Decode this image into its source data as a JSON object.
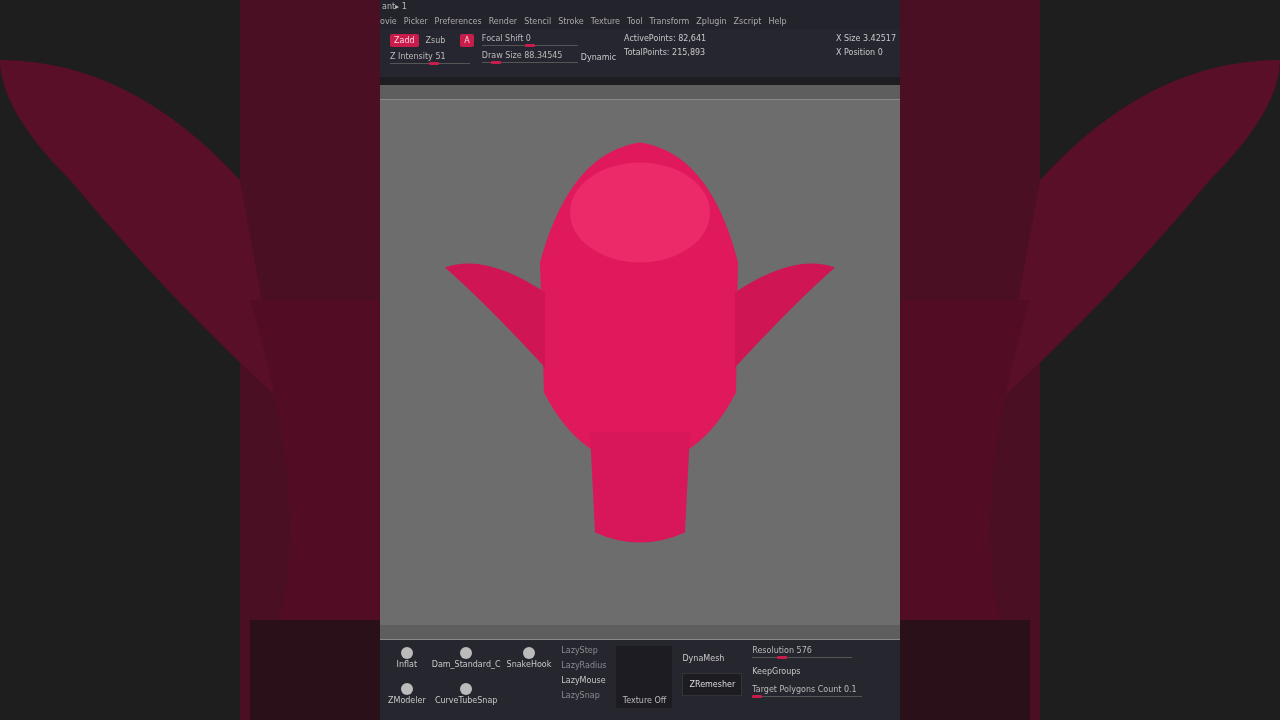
{
  "window": {
    "title": "ant▸ 1"
  },
  "menu": [
    "ovie",
    "Picker",
    "Preferences",
    "Render",
    "Stencil",
    "Stroke",
    "Texture",
    "Tool",
    "Transform",
    "Zplugin",
    "Zscript",
    "Help"
  ],
  "toolbar": {
    "modes": [
      {
        "label": "Zadd",
        "selected": true
      },
      {
        "label": "Zsub",
        "selected": false
      }
    ],
    "rgb": {
      "label": "A",
      "on": true
    },
    "sliders": [
      {
        "label": "Focal Shift 0",
        "level": 0.5
      },
      {
        "label": "Z Intensity 51",
        "level": 0.55
      },
      {
        "label": "Draw Size 88.34545",
        "level": 0.15
      }
    ],
    "dynamic": "Dynamic",
    "stats": [
      "ActivePoints: 82,641",
      "TotalPoints: 215,893"
    ],
    "position": [
      "X Size 3.42517",
      "X Position 0"
    ]
  },
  "shelf": {
    "brushes": [
      "Inflat",
      "Dam_Standard_C",
      "SnakeHook",
      "ZModeler",
      "CurveTubeSnap"
    ],
    "lazy": [
      {
        "label": "LazyStep",
        "disabled": true
      },
      {
        "label": "LazyRadius",
        "disabled": true
      },
      {
        "label": "LazyMouse",
        "disabled": false
      },
      {
        "label": "LazySnap",
        "disabled": true
      }
    ],
    "texture": "Texture Off",
    "dynamesh": "DynaMesh",
    "zremesher": "ZRemesher",
    "resolution": {
      "label": "Resolution 576",
      "level": 0.3
    },
    "keep_groups": "KeepGroups",
    "target": {
      "label": "Target Polygons Count 0.1",
      "level": 0.04
    }
  }
}
